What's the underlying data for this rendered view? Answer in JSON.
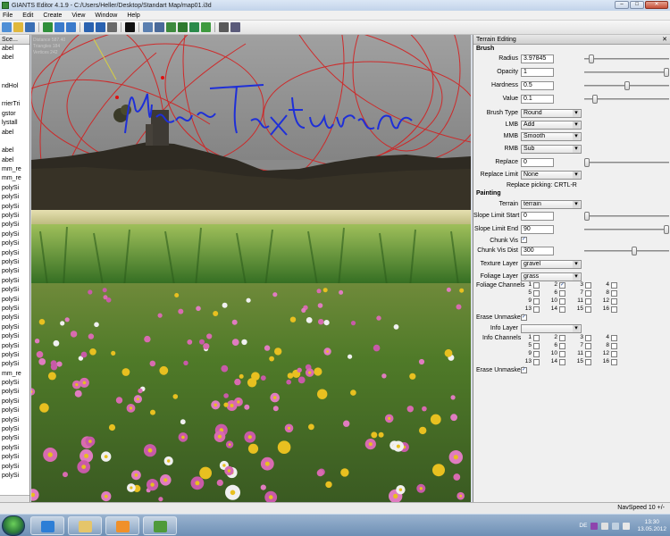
{
  "window": {
    "title": "GIANTS Editor 4.1.9 - C:/Users/Heller/Desktop/Standart Map/map01.i3d",
    "minimize": "–",
    "maximize": "□",
    "close": "✕"
  },
  "menu": [
    "File",
    "Edit",
    "Create",
    "View",
    "Window",
    "Help"
  ],
  "toolbar_icons": [
    {
      "name": "new-icon",
      "color": "#4f8fd6"
    },
    {
      "name": "open-icon",
      "color": "#e0b83c"
    },
    {
      "name": "save-icon",
      "color": "#3a6fb5"
    },
    {
      "name": "refresh-icon",
      "color": "#2f8f3a"
    },
    {
      "name": "import-icon",
      "color": "#3a7acb"
    },
    {
      "name": "export-icon",
      "color": "#3a7acb"
    },
    {
      "name": "undo-icon",
      "color": "#2a62b0"
    },
    {
      "name": "redo-icon",
      "color": "#2a62b0"
    },
    {
      "name": "copy-icon",
      "color": "#6a6a6a"
    },
    {
      "name": "play-icon",
      "color": "#101010"
    },
    {
      "name": "select-tool-icon",
      "color": "#5a7fb0"
    },
    {
      "name": "move-tool-icon",
      "color": "#4a6a9a"
    },
    {
      "name": "terrain-sculpt-icon",
      "color": "#3d8a3d"
    },
    {
      "name": "terrain-paint-icon",
      "color": "#2f7a2f"
    },
    {
      "name": "foliage-paint-icon",
      "color": "#2a8a4a"
    },
    {
      "name": "foliage-erase-icon",
      "color": "#3e9a3e"
    },
    {
      "name": "settings-gear-icon",
      "color": "#5a5a5a"
    },
    {
      "name": "tools-gear-icon",
      "color": "#5a5a7a"
    }
  ],
  "scenegraph": {
    "header": "Sce...",
    "close": "✕",
    "items": [
      "abel",
      "abel",
      "",
      "",
      "ndHol",
      "",
      "rrierTri",
      "gstor",
      "lystall",
      "abel",
      "",
      "abel",
      "abel",
      "mm_re",
      "mm_re",
      "polySi",
      "polySi",
      "polySi",
      "polySi",
      "polySi",
      "polySi",
      "polySi",
      "polySi",
      "polySi",
      "polySi",
      "polySi",
      "polySi",
      "polySi",
      "polySi",
      "polySi",
      "polySi",
      "polySi",
      "polySi",
      "polySi",
      "polySi",
      "mm_re",
      "polySi",
      "polySi",
      "polySi",
      "polySi",
      "polySi",
      "polySi",
      "polySi",
      "polySi",
      "polySi",
      "polySi",
      "polySi"
    ]
  },
  "viewport": {
    "stats": [
      "Distance 587.40",
      "Triangles 184",
      "Vertices 242"
    ],
    "handwriting": "NeueTexturen",
    "handwriting_color": "#1e2fd8",
    "orbit_color": "#d41f1f"
  },
  "panel": {
    "title": "Terrain Editing",
    "close": "✕",
    "brush": {
      "heading": "Brush",
      "radius_label": "Radius",
      "radius": "3.97845",
      "opacity_label": "Opacity",
      "opacity": "1",
      "hardness_label": "Hardness",
      "hardness": "0.5",
      "value_label": "Value",
      "value": "0.1",
      "slider_radius": 0.06,
      "slider_opacity": 1.0,
      "slider_hardness": 0.5,
      "slider_value": 0.1,
      "brush_type_label": "Brush Type",
      "brush_type": "Round",
      "lmb_label": "LMB",
      "lmb": "Add",
      "mmb_label": "MMB",
      "mmb": "Smooth",
      "rmb_label": "RMB",
      "rmb": "Sub",
      "replace_label": "Replace",
      "replace": "0",
      "slider_replace": 0.0,
      "replace_limit_label": "Replace Limit",
      "replace_limit": "None",
      "replace_picking": "Replace picking: CRTL-R"
    },
    "painting": {
      "heading": "Painting",
      "terrain_label": "Terrain",
      "terrain": "terrain",
      "slope_start_label": "Slope Limit Start",
      "slope_start": "0",
      "slider_slope_start": 0.0,
      "slope_end_label": "Slope Limit End",
      "slope_end": "90",
      "slider_slope_end": 1.0,
      "chunk_vis_label": "Chunk Vis",
      "chunk_vis_dist_label": "Chunk Vis Dist",
      "chunk_vis_dist": "300",
      "slider_chunk_vis_dist": 0.6,
      "texture_layer_label": "Texture Layer",
      "texture_layer": "gravel",
      "foliage_layer_label": "Foliage Layer",
      "foliage_layer": "grass",
      "foliage_channels_label": "Foliage Channels",
      "channels": [
        "1",
        "2",
        "3",
        "4",
        "5",
        "6",
        "7",
        "8",
        "9",
        "10",
        "11",
        "12",
        "13",
        "14",
        "15",
        "16"
      ],
      "foliage_checked": [
        false,
        true,
        false,
        false,
        false,
        false,
        false,
        false,
        false,
        false,
        false,
        false,
        false,
        false,
        false,
        false
      ],
      "erase_unmasked_label": "Erase Unmasked",
      "info_layer_label": "Info Layer",
      "info_layer": "",
      "info_channels_label": "Info Channels",
      "erase_unmasked_2_label": "Erase Unmasked"
    }
  },
  "status": {
    "navspeed": "NavSpeed 10 +/-"
  },
  "taskbar": {
    "start": "Start",
    "apps": [
      {
        "name": "ie",
        "color": "#2d7ed6"
      },
      {
        "name": "explorer",
        "color": "#e5c56a"
      },
      {
        "name": "media",
        "color": "#f0902a"
      },
      {
        "name": "giants-editor",
        "color": "#4f9a3a"
      }
    ],
    "lang": "DE",
    "tray_icons": [
      {
        "name": "onenote",
        "color": "#8e44ad"
      },
      {
        "name": "flag",
        "color": "#e0e0e0"
      },
      {
        "name": "network",
        "color": "#c0d0e0"
      },
      {
        "name": "volume",
        "color": "#e8e8e8"
      }
    ],
    "time": "13:30",
    "date": "13.05.2012"
  }
}
